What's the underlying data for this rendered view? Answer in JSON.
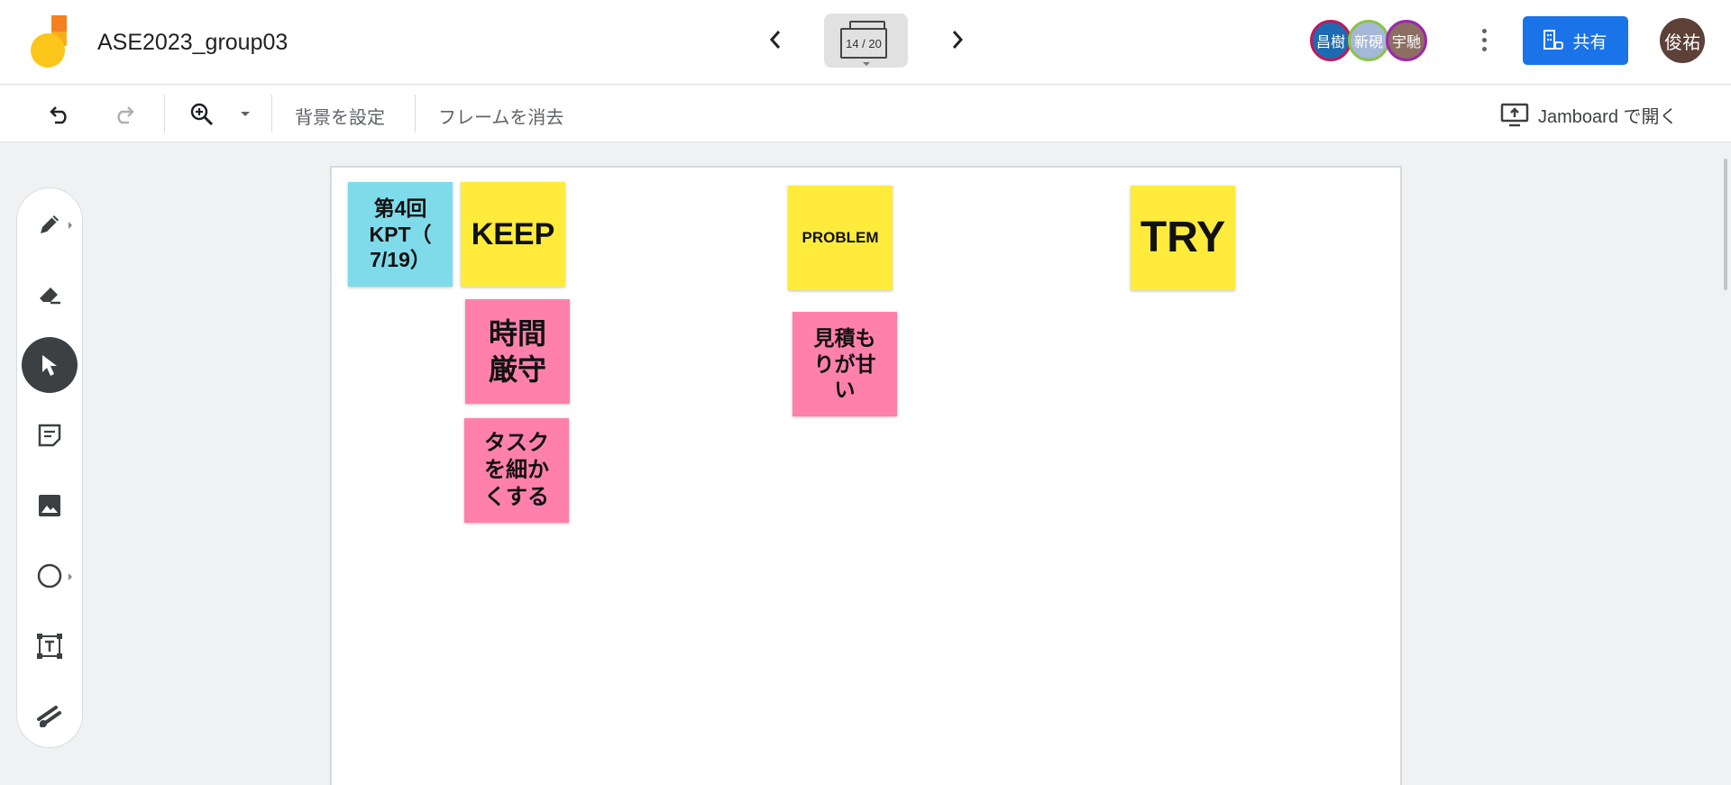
{
  "header": {
    "title": "ASE2023_group03",
    "frame_counter": "14 / 20",
    "collaborators": [
      {
        "name": "昌樹",
        "color": "#1e6ab0",
        "border": "#c2185b"
      },
      {
        "name": "新硯",
        "color": "#a5b8d8",
        "border": "#8bc34a"
      },
      {
        "name": "宇馳",
        "color": "#8d6e63",
        "border": "#9c27b0"
      }
    ],
    "share_label": "共有",
    "user_initials": "俊祐"
  },
  "toolbar": {
    "set_background": "背景を設定",
    "clear_frame": "フレームを消去",
    "open_in_jamboard": "Jamboard で開く"
  },
  "tools": [
    "pen-icon",
    "eraser-icon",
    "select-icon",
    "sticky-note-icon",
    "image-icon",
    "circle-shape-icon",
    "text-box-icon",
    "laser-icon"
  ],
  "canvas": {
    "notes": [
      {
        "id": "note-kpt-4",
        "text": "第4回\nKPT（\n7/19）",
        "color": "blue"
      },
      {
        "id": "note-keep",
        "text": "KEEP",
        "color": "yellow"
      },
      {
        "id": "note-problem",
        "text": "PROBLEM",
        "color": "yellow"
      },
      {
        "id": "note-try",
        "text": "TRY",
        "color": "yellow"
      },
      {
        "id": "note-punctual",
        "text": "時間\n厳守",
        "color": "pink"
      },
      {
        "id": "note-fine-tasks",
        "text": "タスク\nを細か\nくする",
        "color": "pink"
      },
      {
        "id": "note-estimate",
        "text": "見積も\nりが甘\nい",
        "color": "pink"
      }
    ]
  },
  "colors": {
    "accent": "#1a73e8",
    "note_blue": "#7fdbea",
    "note_yellow": "#ffeb3b",
    "note_pink": "#ff80ab"
  }
}
